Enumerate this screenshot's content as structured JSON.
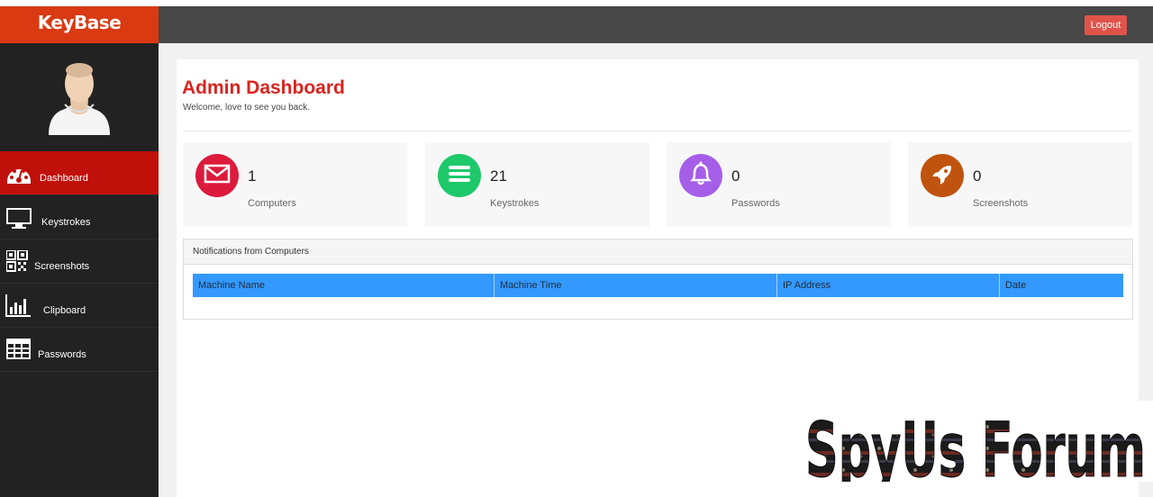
{
  "brand": {
    "name": "KeyBase",
    "color": "#d93a12"
  },
  "header": {
    "logout_label": "Logout"
  },
  "sidebar": {
    "items": [
      {
        "label": "Dashboard",
        "icon": "dashboard-gauge-icon",
        "active": true
      },
      {
        "label": "Keystrokes",
        "icon": "monitor-icon",
        "active": false
      },
      {
        "label": "Screenshots",
        "icon": "qr-code-icon",
        "active": false
      },
      {
        "label": "Clipboard",
        "icon": "bar-chart-icon",
        "active": false
      },
      {
        "label": "Passwords",
        "icon": "table-grid-icon",
        "active": false
      }
    ]
  },
  "main": {
    "title": "Admin Dashboard",
    "subtitle": "Welcome, love to see you back.",
    "stats": [
      {
        "value": "1",
        "label": "Computers",
        "icon": "envelope-icon",
        "color": "#dc1a3c"
      },
      {
        "value": "21",
        "label": "Keystrokes",
        "icon": "list-lines-icon",
        "color": "#1dc96a"
      },
      {
        "value": "0",
        "label": "Passwords",
        "icon": "bell-icon",
        "color": "#a55ee8"
      },
      {
        "value": "0",
        "label": "Screenshots",
        "icon": "rocket-icon",
        "color": "#c0530e"
      }
    ],
    "notifications": {
      "heading": "Notifications from Computers",
      "columns": [
        "Machine Name",
        "Machine Time",
        "IP Address",
        "Date"
      ]
    }
  },
  "watermark": {
    "text": "SpyUs Forum"
  }
}
